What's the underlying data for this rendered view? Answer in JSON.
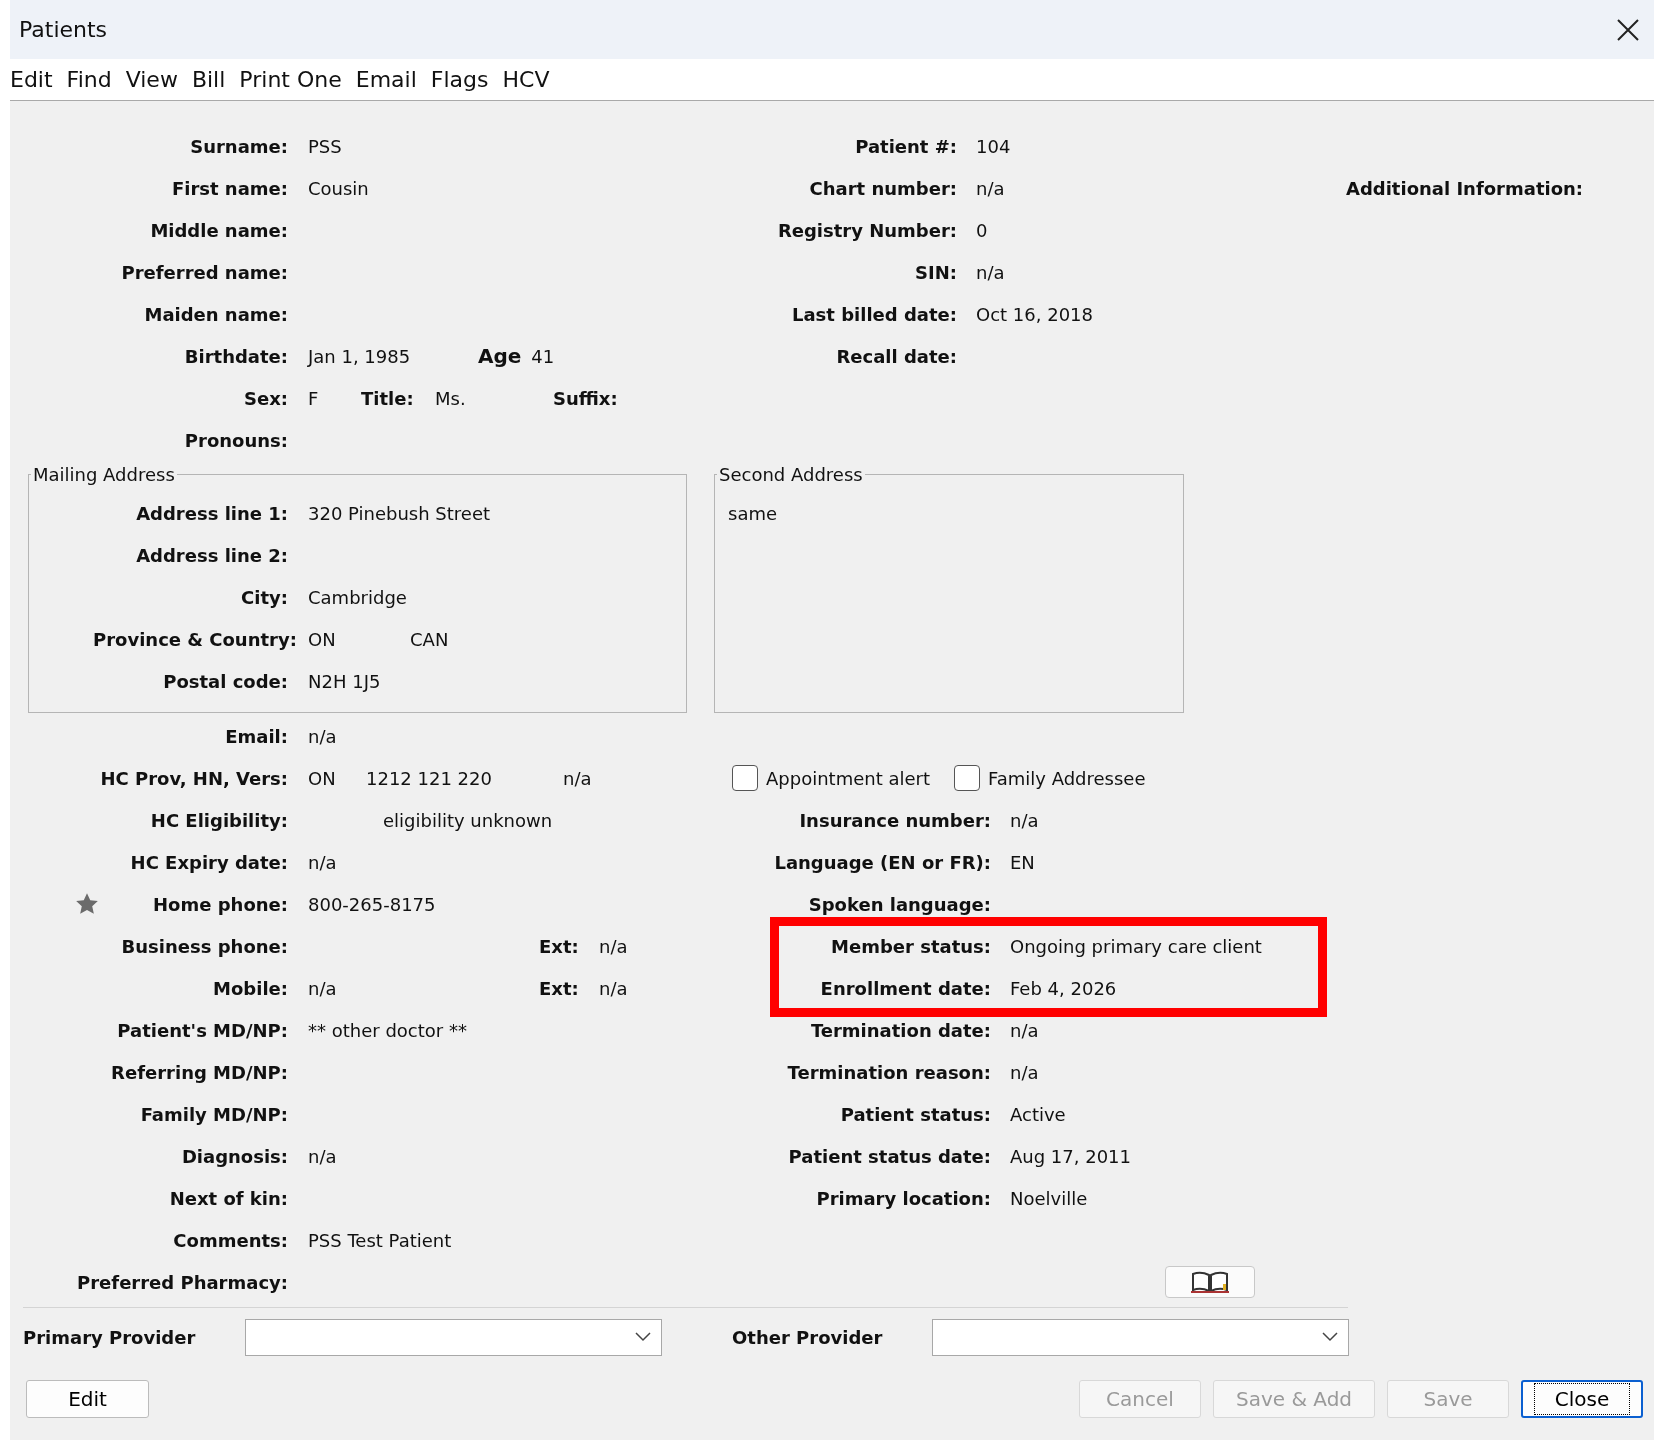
{
  "window": {
    "title": "Patients"
  },
  "menu": [
    "Edit",
    "Find",
    "View",
    "Bill",
    "Print One",
    "Email",
    "Flags",
    "HCV"
  ],
  "identity_left": [
    {
      "kind": "plain",
      "label": "Surname:",
      "value": "PSS"
    },
    {
      "kind": "plain",
      "label": "First name:",
      "value": "Cousin"
    },
    {
      "kind": "plain",
      "label": "Middle name:"
    },
    {
      "kind": "plain",
      "label": "Preferred name:"
    },
    {
      "kind": "plain",
      "label": "Maiden name:"
    },
    {
      "kind": "birth",
      "label": "Birthdate:",
      "value": "Jan 1, 1985",
      "age_label": "Age",
      "age": "41"
    },
    {
      "kind": "sex",
      "label": "Sex:",
      "value": "F",
      "title_label": "Title:",
      "title": "Ms.",
      "suffix_label": "Suffix:"
    },
    {
      "kind": "plain",
      "label": "Pronouns:"
    }
  ],
  "identity_right": [
    {
      "label": "Patient #:",
      "value": "104"
    },
    {
      "label": "Chart number:",
      "value": "n/a"
    },
    {
      "label": "Registry Number:",
      "value": "0"
    },
    {
      "label": "SIN:",
      "value": "n/a"
    },
    {
      "label": "Last billed date:",
      "value": "Oct 16, 2018"
    },
    {
      "label": "Recall date:"
    }
  ],
  "additional_information": {
    "label": "Additional Information:"
  },
  "mailing_address": {
    "title": "Mailing Address",
    "rows": [
      {
        "kind": "plain",
        "label": "Address line 1:",
        "value": "320 Pinebush Street"
      },
      {
        "kind": "plain",
        "label": "Address line 2:"
      },
      {
        "kind": "plain",
        "label": "City:",
        "value": "Cambridge"
      },
      {
        "kind": "province",
        "label": "Province & Country:",
        "values": [
          "ON",
          "CAN"
        ]
      },
      {
        "kind": "plain",
        "label": "Postal code:",
        "value": "N2H 1J5"
      }
    ]
  },
  "second_address": {
    "title": "Second Address",
    "text": "same"
  },
  "details_left": [
    {
      "kind": "plain",
      "label": "Email:",
      "value": "n/a"
    },
    {
      "kind": "hc",
      "label": "HC Prov, HN, Vers:",
      "values": [
        "ON",
        "1212 121 220",
        "n/a"
      ]
    },
    {
      "kind": "eligibility",
      "label": "HC Eligibility:",
      "value": "eligibility unknown"
    },
    {
      "kind": "plain",
      "label": "HC Expiry date:",
      "value": "n/a"
    },
    {
      "kind": "plain",
      "label": "Home phone:",
      "value": "800-265-8175",
      "starred": true
    },
    {
      "kind": "phone",
      "label": "Business phone:",
      "ext_label": "Ext:",
      "ext": "n/a"
    },
    {
      "kind": "phone",
      "label": "Mobile:",
      "value": "n/a",
      "ext_label": "Ext:",
      "ext": "n/a"
    },
    {
      "kind": "plain",
      "label": "Patient's MD/NP:",
      "value": "** other doctor **"
    },
    {
      "kind": "plain",
      "label": "Referring MD/NP:"
    },
    {
      "kind": "plain",
      "label": "Family MD/NP:"
    },
    {
      "kind": "plain",
      "label": "Diagnosis:",
      "value": "n/a"
    },
    {
      "kind": "plain",
      "label": "Next of kin:"
    },
    {
      "kind": "plain",
      "label": "Comments:",
      "value": "PSS Test Patient"
    },
    {
      "kind": "plain",
      "label": "Preferred Pharmacy:"
    }
  ],
  "checkboxes": [
    {
      "label": "Appointment alert",
      "checked": false
    },
    {
      "label": "Family Addressee",
      "checked": false
    }
  ],
  "details_right": [
    {
      "label": "Insurance number:",
      "value": "n/a",
      "highlighted": false
    },
    {
      "label": "Language (EN or FR):",
      "value": "EN",
      "highlighted": false
    },
    {
      "label": "Spoken language:",
      "highlighted": false
    },
    {
      "label": "Member status:",
      "value": "Ongoing primary care client",
      "highlighted": true
    },
    {
      "label": "Enrollment date:",
      "value": "Feb 4, 2026",
      "highlighted": true
    },
    {
      "label": "Termination date:",
      "value": "n/a",
      "highlighted": false
    },
    {
      "label": "Termination reason:",
      "value": "n/a",
      "highlighted": false
    },
    {
      "label": "Patient status:",
      "value": "Active",
      "highlighted": false
    },
    {
      "label": "Patient status date:",
      "value": "Aug 17, 2011",
      "highlighted": false
    },
    {
      "label": "Primary location:",
      "value": "Noelville",
      "highlighted": false
    }
  ],
  "providers": [
    {
      "label": "Primary Provider"
    },
    {
      "label": "Other Provider"
    }
  ],
  "buttons_left": [
    {
      "label": "Edit",
      "disabled": false,
      "focused": false
    }
  ],
  "buttons_right": [
    {
      "label": "Cancel",
      "disabled": true,
      "focused": false
    },
    {
      "label": "Save & Add",
      "disabled": true,
      "focused": false
    },
    {
      "label": "Save",
      "disabled": true,
      "focused": false
    },
    {
      "label": "Close",
      "disabled": false,
      "focused": true
    }
  ]
}
